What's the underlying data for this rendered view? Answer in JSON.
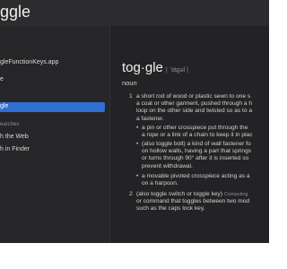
{
  "search": {
    "query": "ggle"
  },
  "sidebar": {
    "top_items": [
      {
        "label": "gleFunctionKeys.app"
      },
      {
        "label": "e"
      }
    ],
    "selected_label": "gle",
    "section_header": "earches",
    "search_items": [
      {
        "label": "h the Web"
      },
      {
        "label": "h in Finder"
      }
    ]
  },
  "entry": {
    "headword": "tog·gle",
    "pronunciation": "| ˈtäɡəl |",
    "part_of_speech": "noun",
    "sense1": {
      "number": "1",
      "lines": [
        "a short rod of wood or plastic sewn to one s",
        "a coat or other garment, pushed through a h",
        "loop on the other side and twisted so as to a",
        "a fastener."
      ],
      "subsenses": [
        {
          "lines": [
            "a pin or other crosspiece put through the",
            "a rope or a link of a chain to keep it in plac"
          ]
        },
        {
          "lines": [
            "(also toggle bolt) a kind of wall fastener fo",
            "on hollow walls, having a part that springs",
            "or turns through 90° after it is inserted so",
            "prevent withdrawal."
          ]
        },
        {
          "lines": [
            "a movable pivoted crosspiece acting as a",
            "on a harpoon."
          ]
        }
      ]
    },
    "sense2": {
      "number": "2",
      "line1_main": "(also toggle switch or toggle key)",
      "line1_tag": "Computing",
      "lines": [
        "or command that toggles between two mod",
        "such as the caps lock key."
      ]
    }
  }
}
